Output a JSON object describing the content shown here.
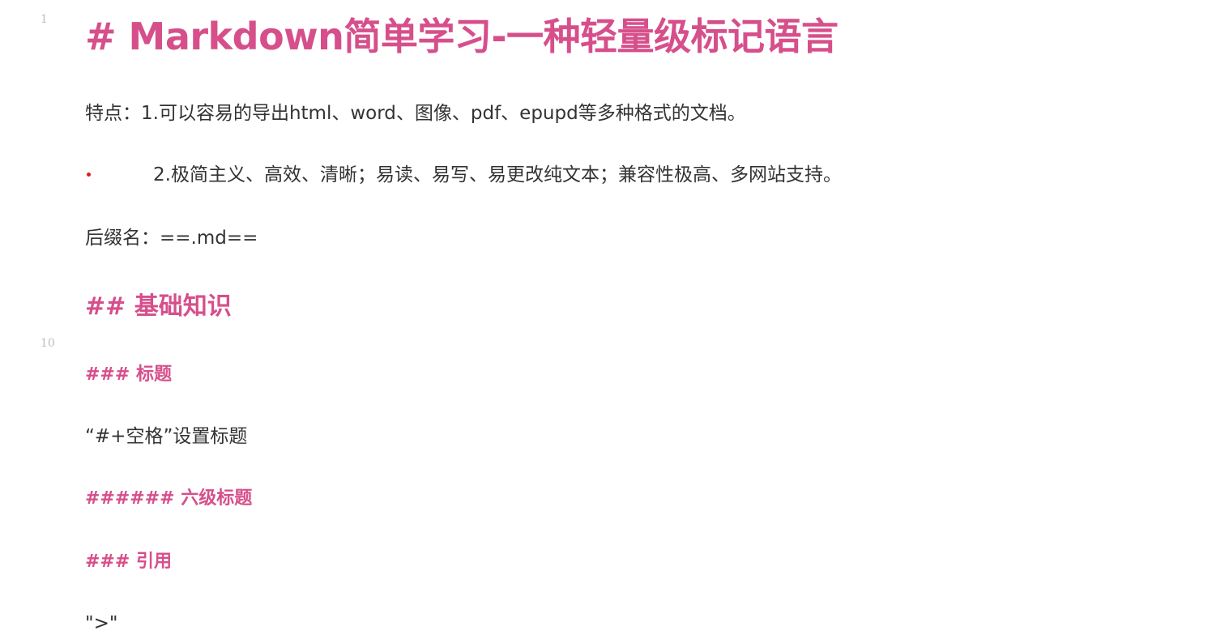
{
  "gutter": {
    "line_numbers": [
      "1",
      "10"
    ]
  },
  "document": {
    "h1": "# Markdown简单学习-一种轻量级标记语言",
    "feature_line": "特点：1.可以容易的导出html、word、图像、pdf、epupd等多种格式的文档。",
    "list_item": "2.极简主义、高效、清晰；易读、易写、易更改纯文本；兼容性极高、多网站支持。",
    "suffix_line": "后缀名：==.md==",
    "h2_basics": "## 基础知识",
    "h3_title": "### 标题",
    "title_desc": "“#+空格”设置标题",
    "h6_title": "###### 六级标题",
    "h3_quote": "### 引用",
    "quote_char": "\">\""
  },
  "colors": {
    "heading": "#d64f8b",
    "body_text": "#333333",
    "bullet": "#e01b1b",
    "line_number": "#bdbdbd"
  }
}
